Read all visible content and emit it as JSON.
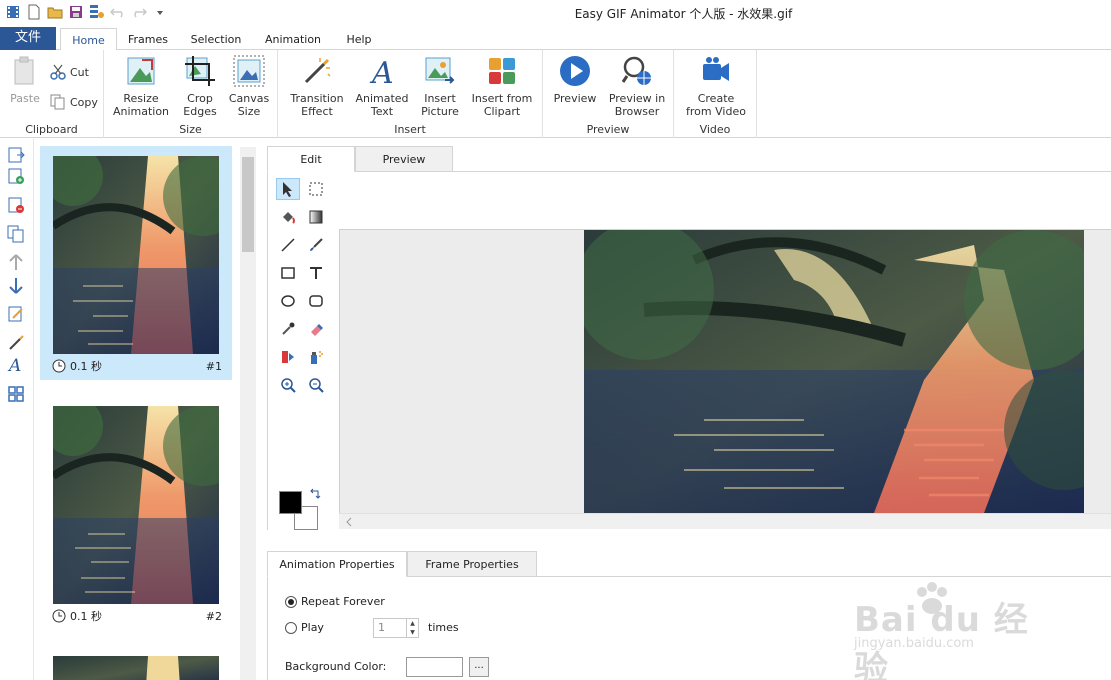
{
  "window": {
    "title": "Easy GIF Animator 个人版 - 水效果.gif"
  },
  "ribbon_tabs": {
    "file": "文件",
    "home": "Home",
    "frames": "Frames",
    "selection": "Selection",
    "animation": "Animation",
    "help": "Help"
  },
  "clipboard": {
    "paste": "Paste",
    "cut": "Cut",
    "copy": "Copy",
    "label": "Clipboard"
  },
  "size": {
    "resize_1": "Resize",
    "resize_2": "Animation",
    "crop_1": "Crop",
    "crop_2": "Edges",
    "canvas_1": "Canvas",
    "canvas_2": "Size",
    "label": "Size"
  },
  "insert": {
    "transition_1": "Transition",
    "transition_2": "Effect",
    "text_1": "Animated",
    "text_2": "Text",
    "picture_1": "Insert",
    "picture_2": "Picture",
    "clipart_1": "Insert from",
    "clipart_2": "Clipart",
    "label": "Insert"
  },
  "preview": {
    "preview": "Preview",
    "browser_1": "Preview in",
    "browser_2": "Browser",
    "label": "Preview"
  },
  "video": {
    "create_1": "Create",
    "create_2": "from Video",
    "label": "Video"
  },
  "frames": [
    {
      "delay": "0.1 秒",
      "number": "#1"
    },
    {
      "delay": "0.1 秒",
      "number": "#2"
    }
  ],
  "editor_tabs": {
    "edit": "Edit",
    "preview": "Preview"
  },
  "prop_tabs": {
    "animation": "Animation Properties",
    "frame": "Frame Properties"
  },
  "props": {
    "repeat": "Repeat Forever",
    "play": "Play",
    "play_count": "1",
    "times": "times",
    "bg_color": "Background Color:",
    "dots": "..."
  },
  "watermark": {
    "text": "Bai du 经验",
    "url": "jingyan.baidu.com"
  },
  "colors": {
    "accent": "#2b5797",
    "selected": "#cce8fb",
    "foreground_color": "#000000",
    "background_color": "#ffffff"
  }
}
